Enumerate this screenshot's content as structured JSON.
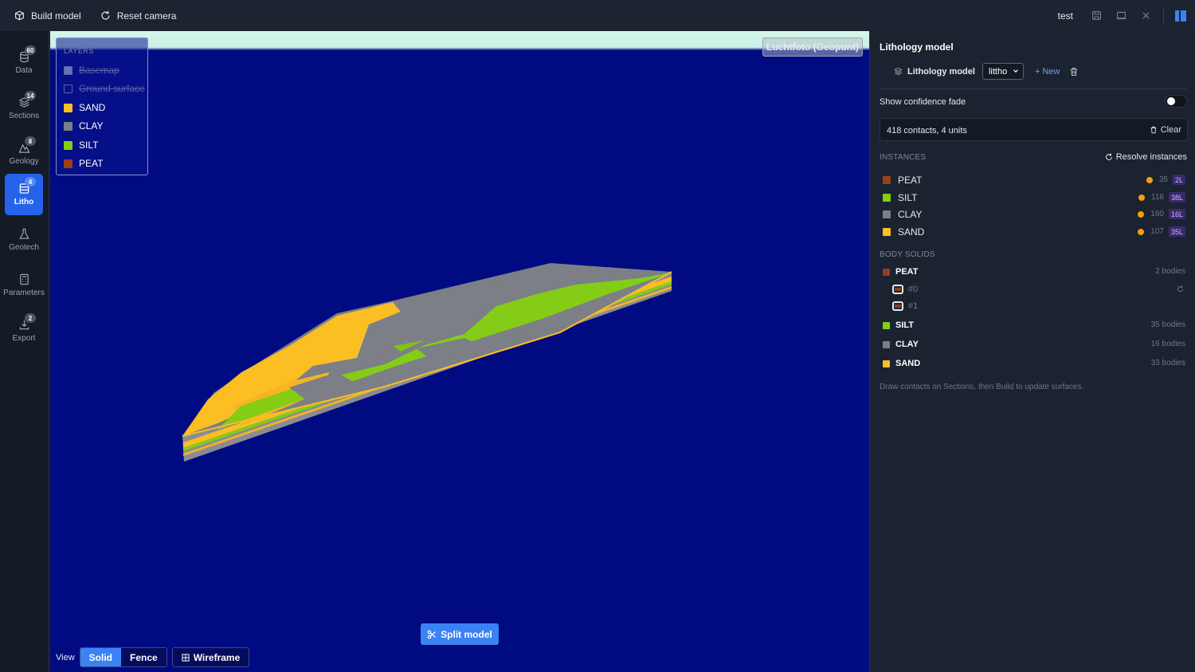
{
  "toolbar": {
    "build_label": "Build model",
    "reset_label": "Reset camera",
    "project_name": "test"
  },
  "sidebar": {
    "items": [
      {
        "label": "Data",
        "badge": "60",
        "icon": "database-icon"
      },
      {
        "label": "Sections",
        "badge": "14",
        "icon": "layers-icon"
      },
      {
        "label": "Geology",
        "badge": "8",
        "icon": "mountain-icon"
      },
      {
        "label": "Litho",
        "badge": "4",
        "icon": "list-icon",
        "active": true
      },
      {
        "label": "Geotech",
        "badge": "",
        "icon": "flask-icon"
      },
      {
        "label": "Parameters",
        "badge": "",
        "icon": "calculator-icon"
      },
      {
        "label": "Export",
        "badge": "2",
        "icon": "download-icon"
      }
    ]
  },
  "viewport": {
    "layers_title": "LAYERS",
    "layers": [
      {
        "label": "Basemap",
        "color": "#6a73b5",
        "enabled": false
      },
      {
        "label": "Ground surface",
        "color": "",
        "enabled": false
      },
      {
        "label": "SAND",
        "color": "#fbbf24",
        "enabled": true
      },
      {
        "label": "CLAY",
        "color": "#7d7f86",
        "enabled": true
      },
      {
        "label": "SILT",
        "color": "#84cc16",
        "enabled": true
      },
      {
        "label": "PEAT",
        "color": "#9a3f1a",
        "enabled": true
      }
    ],
    "basemap_button": "Luchtfoto (Geopunt)",
    "split_label": "Split model",
    "view_label": "View",
    "view_modes": [
      "Solid",
      "Fence"
    ],
    "active_view": "Solid",
    "wireframe_label": "Wireframe"
  },
  "panel": {
    "title": "Lithology model",
    "model_label": "Lithology model",
    "model_selected": "littho",
    "new_label": "New",
    "confidence_label": "Show confidence fade",
    "confidence_on": false,
    "contacts_summary": "418 contacts, 4 units",
    "clear_label": "Clear",
    "instances_header": "INSTANCES",
    "resolve_label": "Resolve instances",
    "instances": [
      {
        "name": "PEAT",
        "color": "#9a3f1a",
        "count": "35",
        "layers": "2L"
      },
      {
        "name": "SILT",
        "color": "#84cc16",
        "count": "116",
        "layers": "38L"
      },
      {
        "name": "CLAY",
        "color": "#7d7f86",
        "count": "160",
        "layers": "16L"
      },
      {
        "name": "SAND",
        "color": "#fbbf24",
        "count": "107",
        "layers": "35L"
      }
    ],
    "bodies_header": "BODY SOLIDS",
    "bodies": [
      {
        "name": "PEAT",
        "color": "#9a3f1a",
        "summary": "2 bodies",
        "children": [
          "#0",
          "#1"
        ]
      },
      {
        "name": "SILT",
        "color": "#84cc16",
        "summary": "35 bodies"
      },
      {
        "name": "CLAY",
        "color": "#7d7f86",
        "summary": "16 bodies"
      },
      {
        "name": "SAND",
        "color": "#fbbf24",
        "summary": "33 bodies"
      }
    ],
    "hint": "Draw contacts on Sections, then Build to update surfaces."
  }
}
